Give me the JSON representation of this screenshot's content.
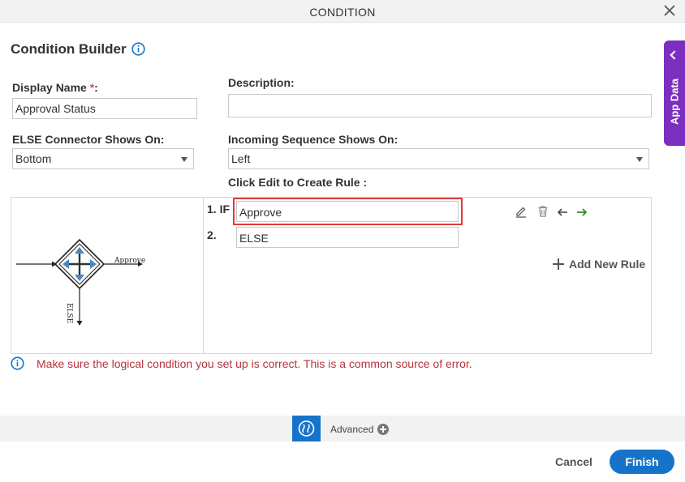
{
  "dialog": {
    "title": "CONDITION"
  },
  "builder": {
    "heading": "Condition Builder"
  },
  "form": {
    "display_name_label": "Display Name",
    "required_mark": "*",
    "display_name_label_colon": ":",
    "display_name_value": "Approval Status",
    "description_label": "Description:",
    "description_value": "",
    "else_connector_label": "ELSE Connector Shows On:",
    "else_connector_value": "Bottom",
    "incoming_sequence_label": "Incoming Sequence Shows On:",
    "incoming_sequence_value": "Left",
    "rule_instruction": "Click Edit to Create Rule :"
  },
  "diagram": {
    "approve_label": "Approve",
    "else_label": "ELSE"
  },
  "rules": [
    {
      "number": "1. IF",
      "value": "Approve"
    },
    {
      "number": "2.",
      "value": "ELSE"
    }
  ],
  "add_rule_label": "Add New Rule",
  "warning": "Make sure the logical condition you set up is correct. This is a common source of error.",
  "side_tab": {
    "label": "App Data"
  },
  "advanced": {
    "label": "Advanced"
  },
  "footer": {
    "cancel_label": "Cancel",
    "finish_label": "Finish"
  },
  "colors": {
    "accent": "#1574c9",
    "side_tab": "#7b2fbe",
    "warning": "#b5343b",
    "highlight": "#e03a3a",
    "arrow_green": "#2e8b2e"
  }
}
